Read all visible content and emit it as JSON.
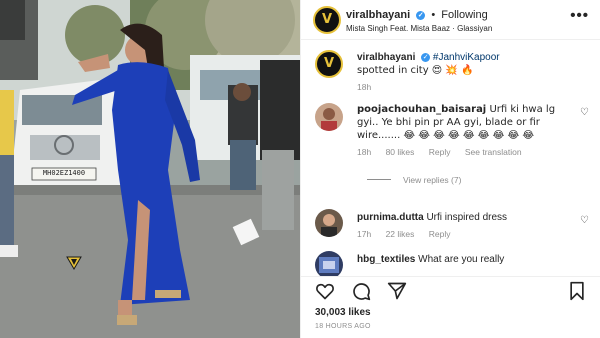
{
  "post": {
    "username": "viralbhayani",
    "follow_status": "Following",
    "audio": "Mista Singh Feat. Mista Baaz · Glassiyan",
    "more_icon": "•••"
  },
  "media": {
    "car_plate": "MH02EZ1400"
  },
  "caption": {
    "username": "viralbhayani",
    "hashtag": "#JanhviKapoor",
    "text": "spotted in city 😍 💥 🔥",
    "age": "18h"
  },
  "comments": [
    {
      "username": "poojachouhan_baisaraj",
      "text": "Urfi ki hwa lg gyi.. Ye bhi pin pr AA gyi, blade or fir wire....... 😂 😂 😂 😂 😂 😂 😂 😂 😂",
      "age": "18h",
      "likes": "80 likes",
      "reply": "Reply",
      "translation": "See translation",
      "view_replies": "View replies (7)"
    },
    {
      "username": "purnima.dutta",
      "text": "Urfi inspired dress",
      "age": "17h",
      "likes": "22 likes",
      "reply": "Reply"
    },
    {
      "username": "hbg_textiles",
      "text": "What are you really"
    }
  ],
  "footer": {
    "likes": "30,003 likes",
    "time_ago": "18 HOURS AGO"
  },
  "colors": {
    "accent_blue": "#3897f0",
    "brand_yellow": "#e6c13a",
    "meta_gray": "#8e8e8e"
  }
}
